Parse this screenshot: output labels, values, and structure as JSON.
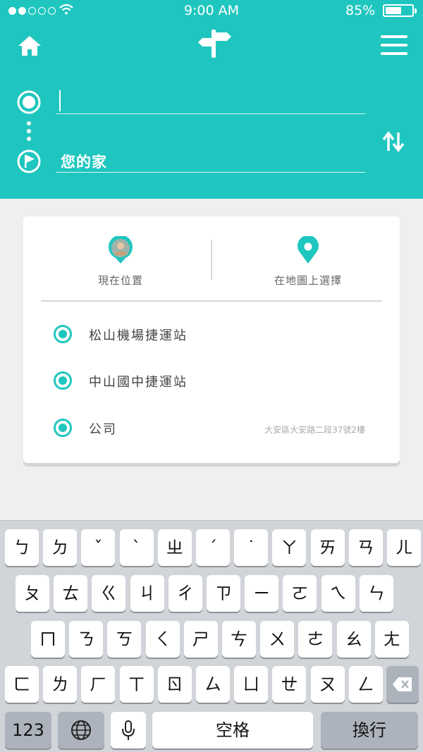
{
  "status_bar": {
    "time": "9:00  AM",
    "battery_pct": "85%",
    "battery_level": 0.85
  },
  "colors": {
    "brand": "#1fc6bf",
    "card_bg": "#ffffff",
    "keyboard_bg": "#d1d4d9"
  },
  "header": {
    "icons": {
      "home": "home-icon",
      "logo": "signpost-icon",
      "menu": "hamburger-menu-icon",
      "swap": "swap-arrows-icon"
    },
    "from_value": "",
    "to_value": "您的家"
  },
  "card": {
    "current_location": "現在位置",
    "choose_on_map": "在地圖上選擇",
    "places": [
      {
        "name": "松山機場捷運站",
        "address": ""
      },
      {
        "name": "中山國中捷運站",
        "address": ""
      },
      {
        "name": "公司",
        "address": "大安區大安路二段37號2樓"
      }
    ]
  },
  "keyboard": {
    "row1": [
      "ㄅ",
      "ㄉ",
      "ˇ",
      "ˋ",
      "ㄓ",
      "ˊ",
      "˙",
      "ㄚ",
      "ㄞ",
      "ㄢ",
      "ㄦ"
    ],
    "row2": [
      "ㄆ",
      "ㄊ",
      "ㄍ",
      "ㄐ",
      "ㄔ",
      "ㄗ",
      "ㄧ",
      "ㄛ",
      "ㄟ",
      "ㄣ"
    ],
    "row3": [
      "ㄇ",
      "ㄋ",
      "ㄎ",
      "ㄑ",
      "ㄕ",
      "ㄘ",
      "ㄨ",
      "ㄜ",
      "ㄠ",
      "ㄤ"
    ],
    "row4": [
      "ㄈ",
      "ㄌ",
      "ㄏ",
      "ㄒ",
      "ㄖ",
      "ㄙ",
      "ㄩ",
      "ㄝ",
      "ㄡ",
      "ㄥ"
    ],
    "numbers_label": "123",
    "space_label": "空格",
    "return_label": "換行"
  }
}
